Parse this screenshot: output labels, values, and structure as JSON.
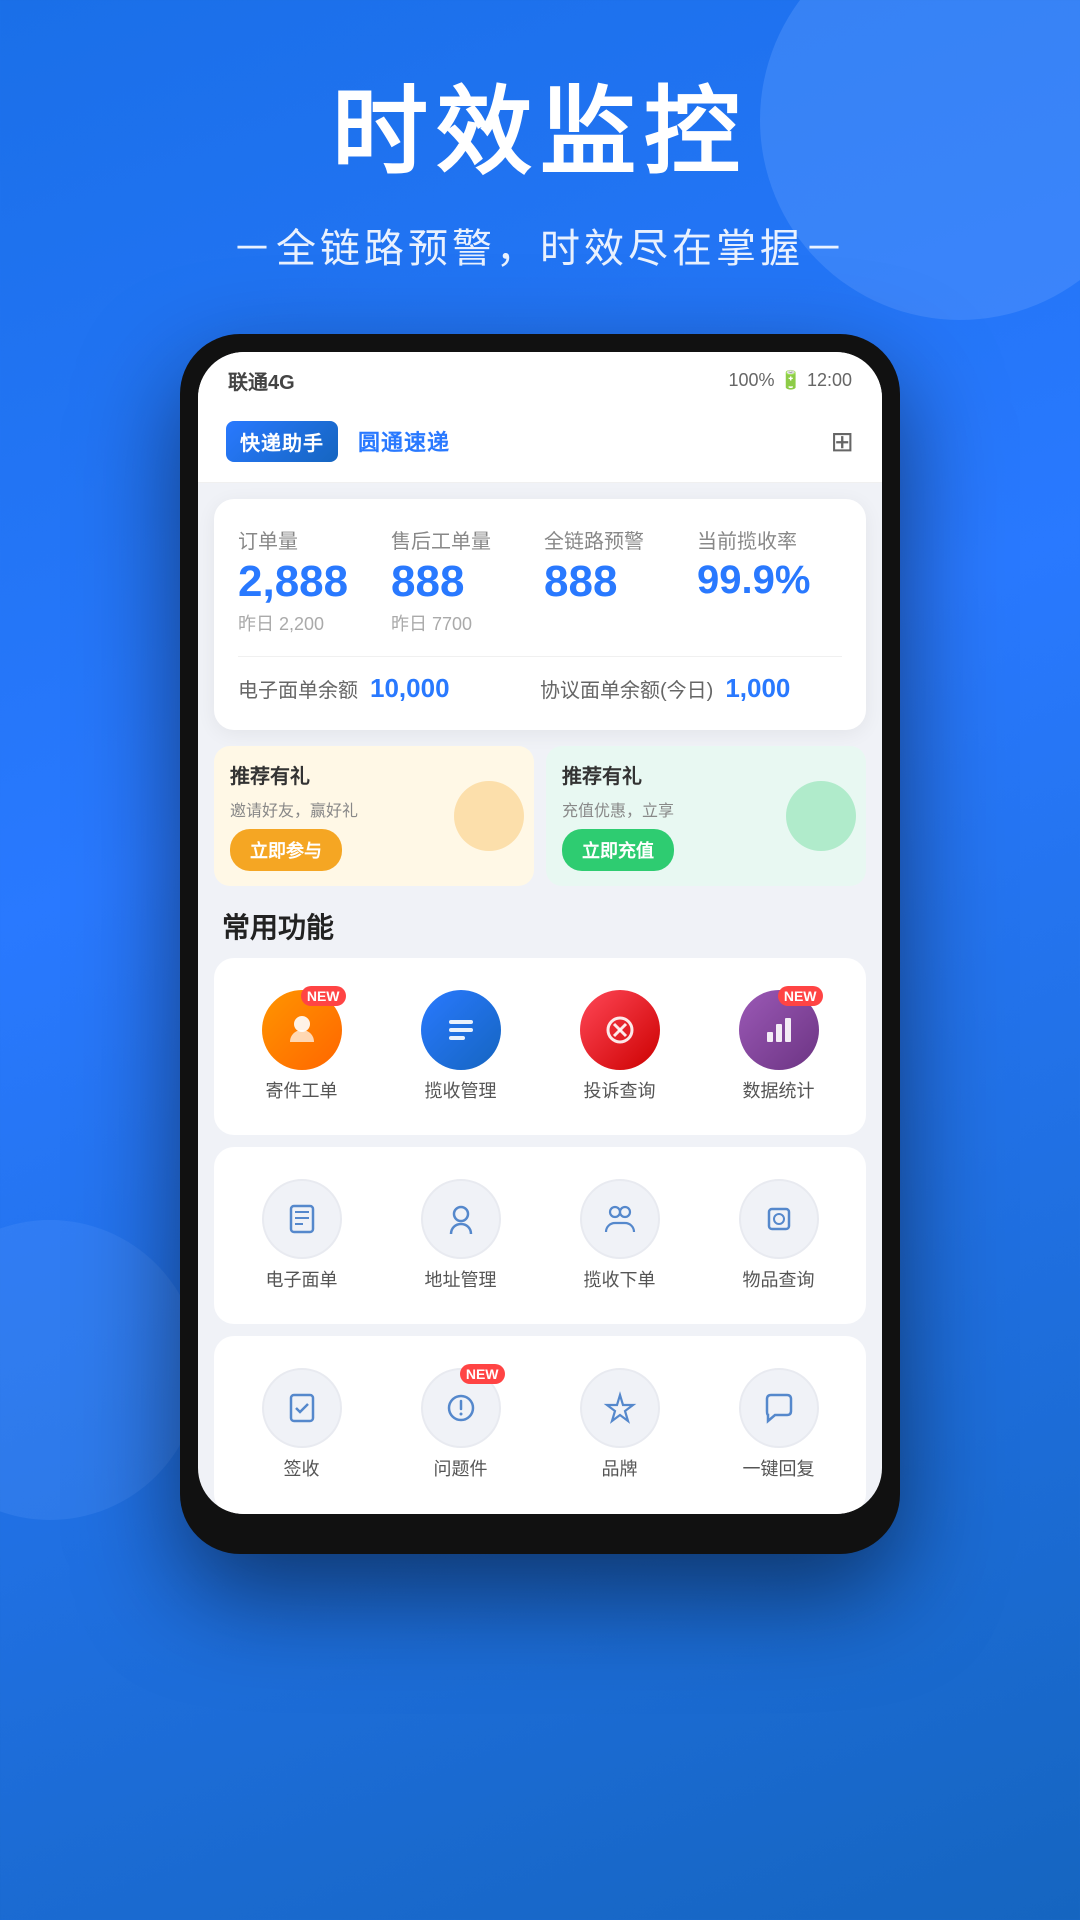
{
  "hero": {
    "title": "时效监控",
    "subtitle": "－全链路预警，时效尽在掌握－"
  },
  "statusBar": {
    "left": "联通4G",
    "right": "100% 🔋 12:00"
  },
  "appHeader": {
    "logo1": "快递助手",
    "logo2": "圆通速递",
    "iconLabel": "扫码"
  },
  "stats": {
    "items": [
      {
        "label": "订单量",
        "value": "2,888",
        "prev": "昨日 2,200"
      },
      {
        "label": "售后工单量",
        "value": "888",
        "prev": "昨日 7700"
      },
      {
        "label": "全链路预警",
        "value": "888",
        "prev": ""
      },
      {
        "label": "当前揽收率",
        "value": "99.9%",
        "prev": ""
      }
    ],
    "balance": {
      "electronic_label": "电子面单余额",
      "electronic_value": "10,000",
      "agreement_label": "协议面单余额(今日)",
      "agreement_value": "1,000"
    }
  },
  "banners": [
    {
      "text1": "推荐有礼",
      "text2": "邀请好友，赢好礼",
      "btn": "立即参与",
      "type": "yellow"
    },
    {
      "text1": "推荐有礼",
      "text2": "充值优惠，立享",
      "btn": "立即充值",
      "type": "green"
    }
  ],
  "commonFunctions": {
    "title": "常用功能",
    "row1": [
      {
        "label": "寄件工单",
        "color": "orange",
        "badge": "NEW",
        "icon": "📦"
      },
      {
        "label": "揽收管理",
        "color": "blue",
        "badge": "",
        "icon": "📋"
      },
      {
        "label": "投诉查询",
        "color": "red",
        "badge": "",
        "icon": "🔍"
      },
      {
        "label": "数据统计",
        "color": "purple",
        "badge": "NEW",
        "icon": "📊"
      }
    ],
    "row2": [
      {
        "label": "电子面单",
        "icon": "🧾",
        "badge": ""
      },
      {
        "label": "地址管理",
        "icon": "👤",
        "badge": ""
      },
      {
        "label": "揽收下单",
        "icon": "👥",
        "badge": ""
      },
      {
        "label": "物品查询",
        "icon": "🔒",
        "badge": ""
      }
    ],
    "row3": [
      {
        "label": "签收",
        "icon": "✅",
        "badge": ""
      },
      {
        "label": "问题件",
        "icon": "⚙️",
        "badge": "NEW"
      },
      {
        "label": "品牌",
        "icon": "🏷️",
        "badge": ""
      },
      {
        "label": "一键回复",
        "icon": "💬",
        "badge": ""
      }
    ]
  }
}
